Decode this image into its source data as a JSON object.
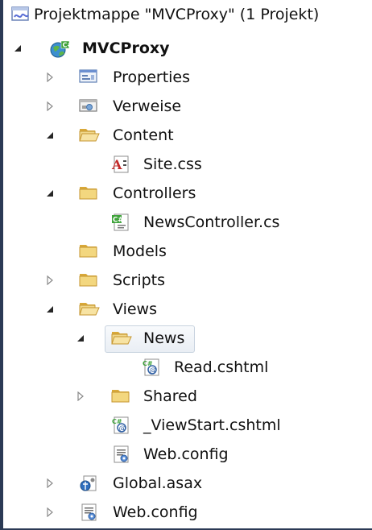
{
  "solution_explorer": {
    "items": [
      {
        "label": "Projektmappe \"MVCProxy\" (1 Projekt)",
        "icon": "solution-icon",
        "expander": "none"
      },
      {
        "label": "MVCProxy",
        "icon": "web-project-icon",
        "expander": "expanded",
        "bold": true
      },
      {
        "label": "Properties",
        "icon": "properties-icon",
        "expander": "collapsed"
      },
      {
        "label": "Verweise",
        "icon": "references-icon",
        "expander": "collapsed"
      },
      {
        "label": "Content",
        "icon": "folder-open-icon",
        "expander": "expanded"
      },
      {
        "label": "Site.css",
        "icon": "css-file-icon",
        "expander": "none"
      },
      {
        "label": "Controllers",
        "icon": "folder-icon",
        "expander": "expanded"
      },
      {
        "label": "NewsController.cs",
        "icon": "csharp-file-icon",
        "expander": "none"
      },
      {
        "label": "Models",
        "icon": "folder-icon",
        "expander": "none"
      },
      {
        "label": "Scripts",
        "icon": "folder-icon",
        "expander": "collapsed"
      },
      {
        "label": "Views",
        "icon": "folder-open-icon",
        "expander": "expanded"
      },
      {
        "label": "News",
        "icon": "folder-open-icon",
        "expander": "expanded",
        "selected": true
      },
      {
        "label": "Read.cshtml",
        "icon": "cshtml-file-icon",
        "expander": "none"
      },
      {
        "label": "Shared",
        "icon": "folder-icon",
        "expander": "collapsed"
      },
      {
        "label": "_ViewStart.cshtml",
        "icon": "cshtml-file-icon",
        "expander": "none"
      },
      {
        "label": "Web.config",
        "icon": "config-file-icon",
        "expander": "none"
      },
      {
        "label": "Global.asax",
        "icon": "global-asax-icon",
        "expander": "collapsed"
      },
      {
        "label": "Web.config",
        "icon": "config-file-icon",
        "expander": "collapsed"
      }
    ]
  },
  "colors": {
    "background_frame": "#2b3a55",
    "folder": "#e8c15a",
    "selection_border": "#c8d3df"
  }
}
